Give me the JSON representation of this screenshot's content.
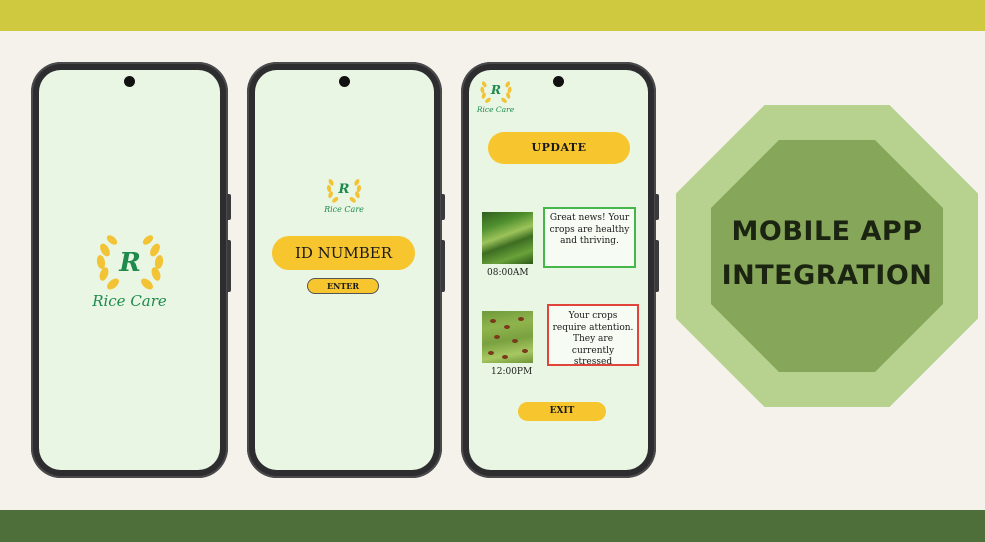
{
  "app": {
    "name": "Rice Care",
    "logo_letter": "R"
  },
  "login": {
    "id_label": "ID NUMBER",
    "enter_label": "ENTER"
  },
  "dashboard": {
    "update_label": "UPDATE",
    "updates": [
      {
        "time": "08:00AM",
        "message": "Great news! Your crops are healthy and thriving.",
        "status": "healthy",
        "border_color": "#45b649"
      },
      {
        "time": "12:00PM",
        "message": "Your crops require attention. They are currently stressed",
        "status": "stressed",
        "border_color": "#e0443a"
      }
    ],
    "exit_label": "EXIT"
  },
  "banner": {
    "line1": "MOBILE APP",
    "line2": "INTEGRATION"
  },
  "colors": {
    "top_band": "#cfc93f",
    "bottom_band": "#4e6e3a",
    "screen": "#e9f6e4",
    "accent_yellow": "#f7c52d",
    "brand_green": "#1f8a4c",
    "octagon_outer": "#b7d28f",
    "octagon_inner": "#86a65a"
  }
}
